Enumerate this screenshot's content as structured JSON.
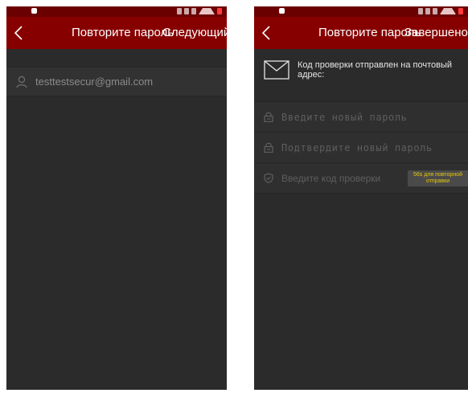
{
  "left_screen": {
    "header": {
      "title": "Повторите пароль",
      "action_label": "Следующий"
    },
    "email_value": "testtestsecur@gmail.com"
  },
  "right_screen": {
    "header": {
      "title": "Повторите пароль",
      "action_label": "Завершено"
    },
    "notice": "Код проверки отправлен на почтовый адрес:",
    "fields": [
      {
        "placeholder": "Введите новый пароль",
        "icon": "lock-icon"
      },
      {
        "placeholder": "Подтвердите новый пароль",
        "icon": "lock-icon"
      },
      {
        "placeholder": "Введите код проверки",
        "icon": "shield-check-icon"
      }
    ],
    "resend_label": "56s для повторной отправки"
  },
  "colors": {
    "header_bg": "#870000",
    "status_bg": "#6b0000",
    "screen_bg": "#2b2b2b",
    "countdown_text": "#e8c90a"
  }
}
